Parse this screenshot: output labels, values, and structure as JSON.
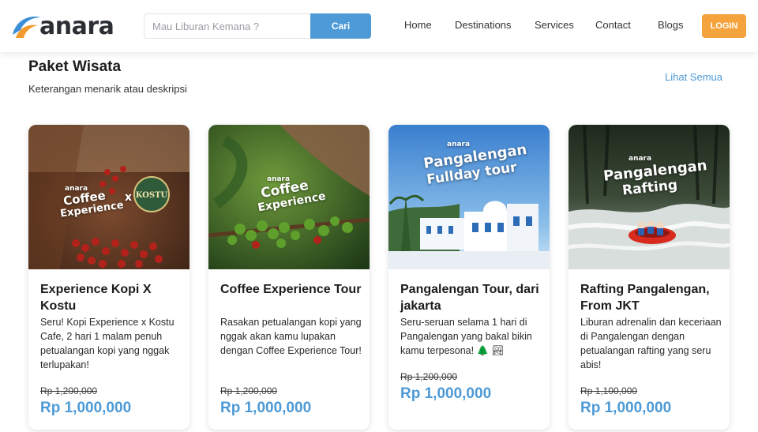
{
  "brand": {
    "name": "anara"
  },
  "search": {
    "placeholder": "Mau Liburan Kemana ?",
    "button_label": "Cari"
  },
  "nav": [
    {
      "label": "Home"
    },
    {
      "label": "Destinations"
    },
    {
      "label": "Services"
    },
    {
      "label": "Contact"
    },
    {
      "label": "Blogs"
    }
  ],
  "login_label": "LOGIN",
  "section": {
    "title": "Paket Wisata",
    "description": "Keterangan menarik atau deskripsi",
    "see_all": "Lihat Semua"
  },
  "cards": [
    {
      "title": "Experience Kopi X Kostu",
      "description": "Seru! Kopi Experience x Kostu Cafe, 2 hari 1 malam penuh petualangan kopi yang nggak terlupakan!",
      "old_price": "Rp 1,200,000",
      "price": "Rp 1,000,000",
      "image_text": {
        "brand": "anara",
        "line1": "Coffee",
        "line2": "Experience",
        "extra": "x",
        "badge": "KOSTU"
      }
    },
    {
      "title": "Coffee Experience Tour",
      "description": "Rasakan petualangan kopi yang nggak akan kamu lupakan dengan Coffee Experience Tour!",
      "old_price": "Rp 1,200,000",
      "price": "Rp 1,000,000",
      "image_text": {
        "brand": "anara",
        "line1": "Coffee",
        "line2": "Experience"
      }
    },
    {
      "title": "Pangalengan Tour, dari jakarta",
      "description": "Seru-seruan selama 1 hari di Pangalengan yang bakal bikin kamu terpesona! 🌲 🏞",
      "old_price": "Rp 1,200,000",
      "price": "Rp 1,000,000",
      "image_text": {
        "brand": "anara",
        "line1": "Pangalengan",
        "line2": "Fullday tour"
      }
    },
    {
      "title": "Rafting Pangalengan, From JKT",
      "description": "Liburan adrenalin dan keceriaan di Pangalengan dengan petualangan rafting yang seru abis!",
      "old_price": "Rp 1,100,000",
      "price": "Rp 1,000,000",
      "image_text": {
        "brand": "anara",
        "line1": "Pangalengan",
        "line2": "Rafting"
      }
    }
  ],
  "colors": {
    "accent": "#4d9ad6",
    "login": "#f5a33d"
  }
}
